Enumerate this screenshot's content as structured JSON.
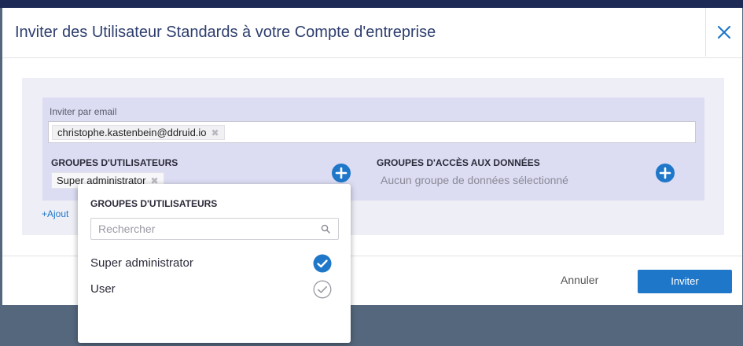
{
  "modal": {
    "title": "Inviter des Utilisateur Standards à votre Compte d'entreprise"
  },
  "email": {
    "label": "Inviter par email",
    "chips": [
      {
        "value": "christophe.kastenbein@ddruid.io"
      }
    ]
  },
  "user_groups": {
    "label": "GROUPES D'UTILISATEURS",
    "chips": [
      {
        "value": "Super administrator"
      }
    ]
  },
  "data_groups": {
    "label": "GROUPES D'ACCÈS AUX DONNÉES",
    "empty_text": "Aucun groupe de données sélectionné"
  },
  "add_link": "+Ajout",
  "footer": {
    "cancel_label": "Annuler",
    "invite_label": "Inviter"
  },
  "dropdown": {
    "title": "GROUPES D'UTILISATEURS",
    "search_placeholder": "Rechercher",
    "items": [
      {
        "label": "Super administrator",
        "selected": true
      },
      {
        "label": "User",
        "selected": false
      }
    ]
  },
  "icons": {
    "close": "close-icon",
    "add": "plus-circle-icon",
    "search": "search-icon",
    "check_selected": "check-circle-filled-icon",
    "check_unselected": "check-circle-outline-icon"
  },
  "colors": {
    "accent": "#1f77c9",
    "title": "#2e3e6e",
    "panel": "#dcdcf3",
    "backdrop": "#55677d"
  }
}
